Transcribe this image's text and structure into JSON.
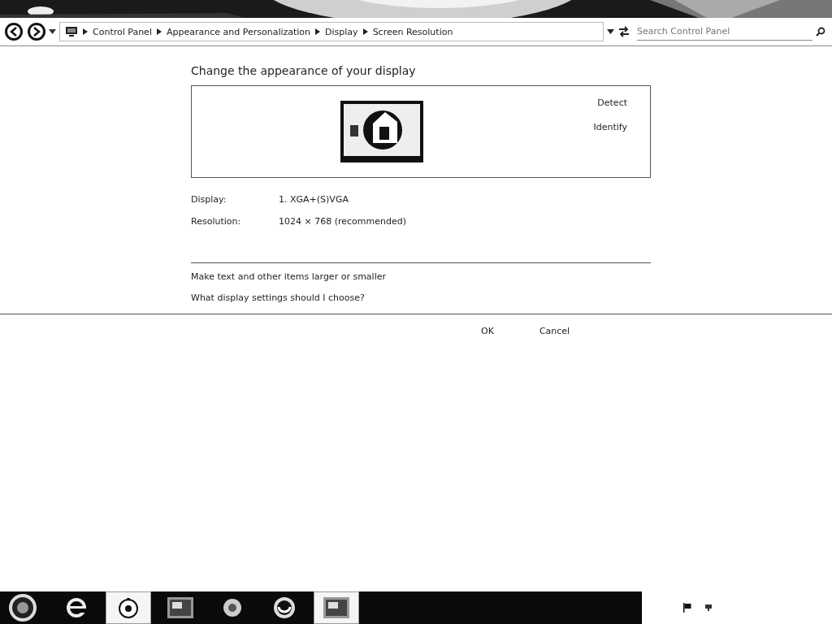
{
  "address_bar": {
    "breadcrumbs": [
      {
        "label": "Control Panel"
      },
      {
        "label": "Appearance and Personalization"
      },
      {
        "label": "Display"
      },
      {
        "label": "Screen Resolution"
      }
    ],
    "search": {
      "placeholder": "Search Control Panel"
    }
  },
  "content": {
    "heading": "Change the appearance of your display",
    "monitor_actions": [
      "Detect",
      "Identify"
    ],
    "fields": [
      {
        "label": "Display:",
        "value": "1. XGA+(S)VGA"
      },
      {
        "label": "Resolution:",
        "value": "1024 × 768 (recommended)"
      }
    ],
    "links": [
      "Make text and other items larger or smaller",
      "What display settings should I choose?"
    ]
  },
  "buttons": [
    "OK",
    "Cancel"
  ],
  "taskbar": {
    "items": [
      {
        "kind": "browser",
        "selected": false
      },
      {
        "kind": "media",
        "selected": true
      },
      {
        "kind": "app",
        "selected": false
      },
      {
        "kind": "disc",
        "selected": false
      },
      {
        "kind": "swirl",
        "selected": false
      },
      {
        "kind": "app",
        "selected": true
      }
    ]
  }
}
